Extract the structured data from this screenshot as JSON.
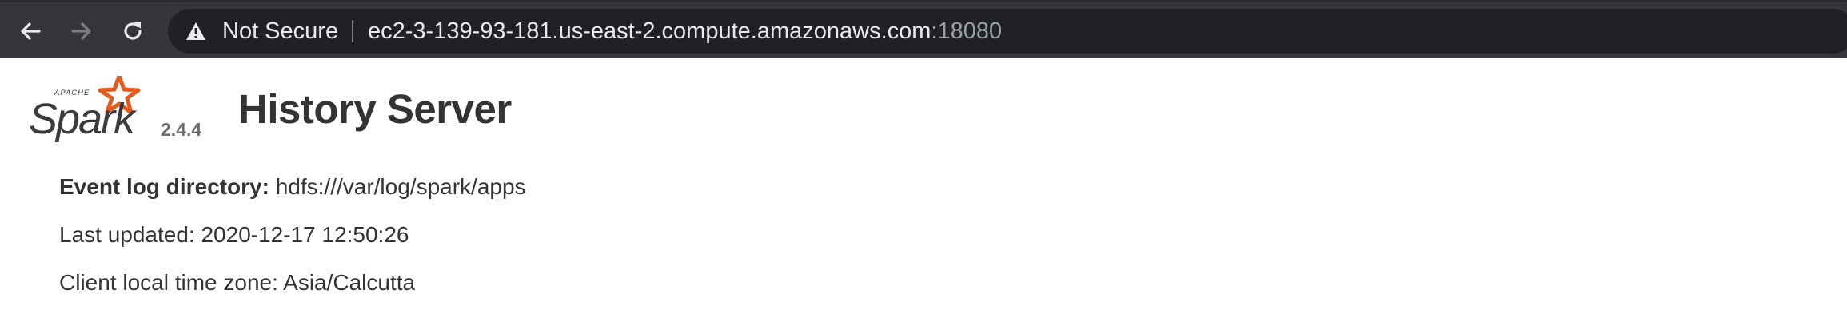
{
  "browser": {
    "security_label": "Not Secure",
    "url_host": "ec2-3-139-93-181.us-east-2.compute.amazonaws.com",
    "url_port": ":18080",
    "icons": [
      "back-icon",
      "forward-icon",
      "reload-icon",
      "warning-icon"
    ]
  },
  "header": {
    "logo_top_text": "APACHE",
    "logo_text": "Spark",
    "version": "2.4.4",
    "title": "History Server"
  },
  "info": {
    "event_log_label": "Event log directory:",
    "event_log_value": "hdfs:///var/log/spark/apps",
    "last_updated_label": "Last updated:",
    "last_updated_value": "2020-12-17 12:50:26",
    "timezone_label": "Client local time zone:",
    "timezone_value": "Asia/Calcutta"
  },
  "colors": {
    "toolbar": "#35363a",
    "omnibox": "#202124",
    "spark_orange": "#e25a1c",
    "text": "#333333"
  }
}
